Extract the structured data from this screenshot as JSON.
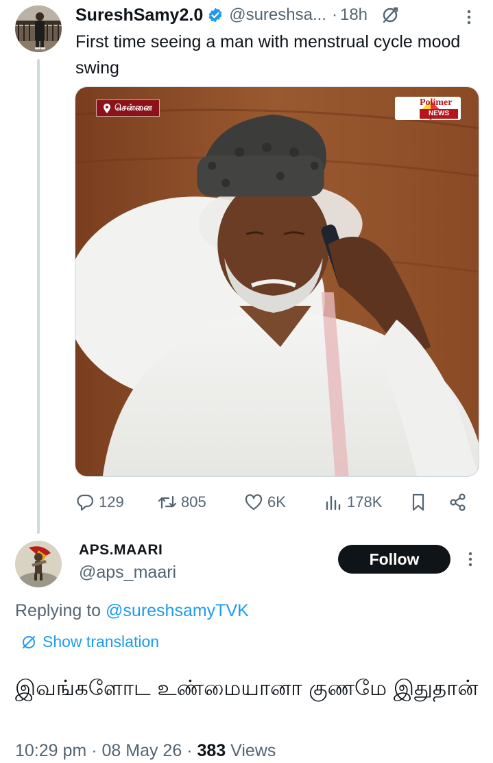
{
  "parent_tweet": {
    "display_name": "SureshSamy2.0",
    "handle": "@sureshsa...",
    "separator": "·",
    "time": "18h",
    "text": "First time seeing a man with menstrual cycle mood swing",
    "media": {
      "location_badge": "சென்னை",
      "channel_logo": "Polimer",
      "channel_logo_sub": "NEWS"
    },
    "actions": {
      "replies": "129",
      "reposts": "805",
      "likes": "6K",
      "views": "178K"
    }
  },
  "reply_tweet": {
    "display_name": "APS.MAARI",
    "handle": "@aps_maari",
    "follow_label": "Follow",
    "replying_prefix": "Replying to",
    "replying_mention": "@sureshsamyTVK",
    "translate_label": "Show translation",
    "text": "இவங்களோட உண்மையானா குணமே இதுதான்",
    "time": "10:29 pm",
    "date": "08 May 26",
    "views_count": "383",
    "views_label": "Views",
    "separator": "·"
  },
  "colors": {
    "accent": "#1d9bf0",
    "text_primary": "#0f1419",
    "text_secondary": "#536471",
    "follow_bg": "#0f1419"
  },
  "icons": [
    "verified-badge-icon",
    "grok-icon",
    "more-icon",
    "reply-icon",
    "repost-icon",
    "like-icon",
    "views-icon",
    "bookmark-icon",
    "share-icon",
    "translate-icon",
    "location-pin-icon"
  ]
}
